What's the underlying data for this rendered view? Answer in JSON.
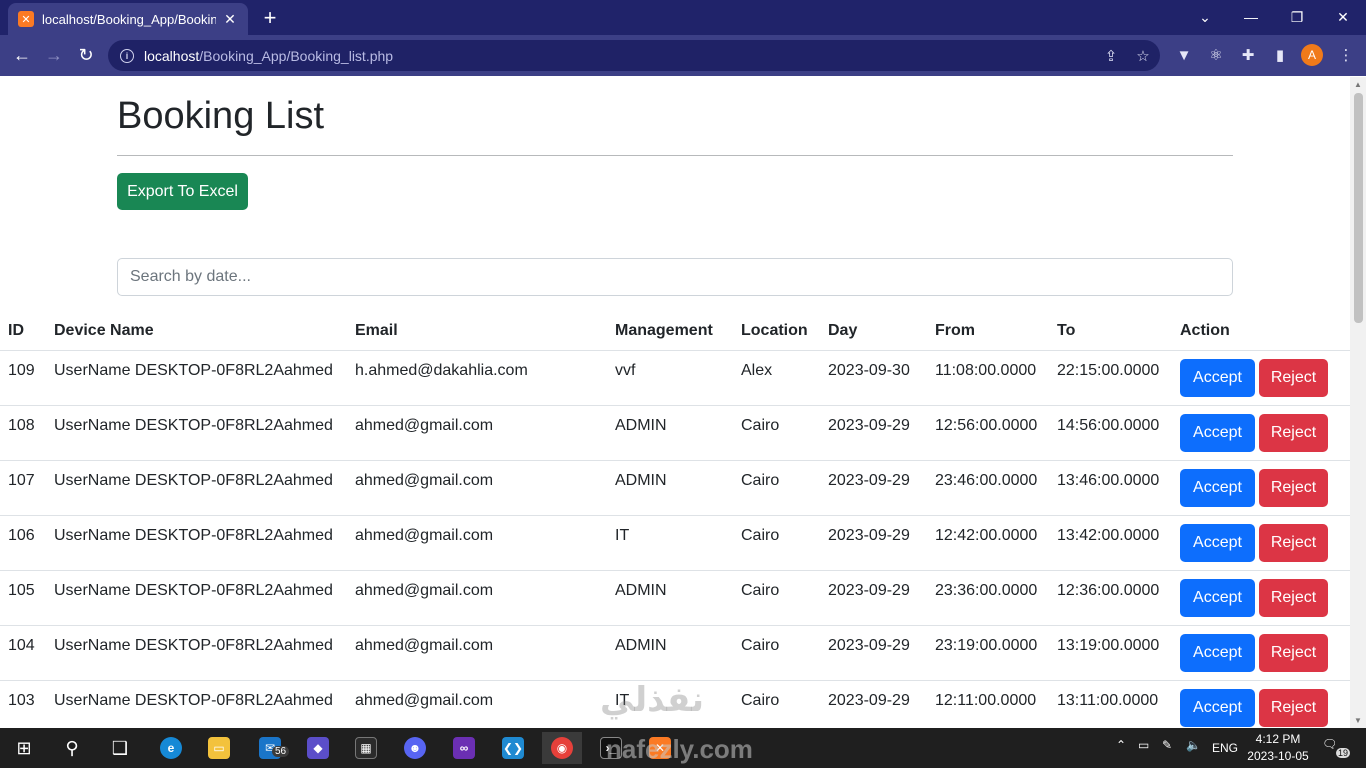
{
  "browser": {
    "tab_title": "localhost/Booking_App/Booking",
    "url_host": "localhost",
    "url_path": "/Booking_App/Booking_list.php",
    "profile_initial": "A"
  },
  "page": {
    "title": "Booking List",
    "export_label": "Export To Excel",
    "search_placeholder": "Search by date..."
  },
  "table": {
    "headers": [
      "ID",
      "Device Name",
      "Email",
      "Management",
      "Location",
      "Day",
      "From",
      "To",
      "Action"
    ],
    "accept_label": "Accept",
    "reject_label": "Reject",
    "rows": [
      {
        "id": "109",
        "device": "UserName DESKTOP-0F8RL2Aahmed",
        "email": "h.ahmed@dakahlia.com",
        "management": "vvf",
        "location": "Alex",
        "day": "2023-09-30",
        "from": "11:08:00.0000",
        "to": "22:15:00.0000"
      },
      {
        "id": "108",
        "device": "UserName DESKTOP-0F8RL2Aahmed",
        "email": "ahmed@gmail.com",
        "management": "ADMIN",
        "location": "Cairo",
        "day": "2023-09-29",
        "from": "12:56:00.0000",
        "to": "14:56:00.0000"
      },
      {
        "id": "107",
        "device": "UserName DESKTOP-0F8RL2Aahmed",
        "email": "ahmed@gmail.com",
        "management": "ADMIN",
        "location": "Cairo",
        "day": "2023-09-29",
        "from": "23:46:00.0000",
        "to": "13:46:00.0000"
      },
      {
        "id": "106",
        "device": "UserName DESKTOP-0F8RL2Aahmed",
        "email": "ahmed@gmail.com",
        "management": "IT",
        "location": "Cairo",
        "day": "2023-09-29",
        "from": "12:42:00.0000",
        "to": "13:42:00.0000"
      },
      {
        "id": "105",
        "device": "UserName DESKTOP-0F8RL2Aahmed",
        "email": "ahmed@gmail.com",
        "management": "ADMIN",
        "location": "Cairo",
        "day": "2023-09-29",
        "from": "23:36:00.0000",
        "to": "12:36:00.0000"
      },
      {
        "id": "104",
        "device": "UserName DESKTOP-0F8RL2Aahmed",
        "email": "ahmed@gmail.com",
        "management": "ADMIN",
        "location": "Cairo",
        "day": "2023-09-29",
        "from": "23:19:00.0000",
        "to": "13:19:00.0000"
      },
      {
        "id": "103",
        "device": "UserName DESKTOP-0F8RL2Aahmed",
        "email": "ahmed@gmail.com",
        "management": "IT",
        "location": "Cairo",
        "day": "2023-09-29",
        "from": "12:11:00.0000",
        "to": "13:11:00.0000"
      }
    ]
  },
  "taskbar": {
    "mail_badge": "56",
    "language": "ENG",
    "time": "4:12 PM",
    "date": "2023-10-05",
    "notifications": "19"
  },
  "watermark": {
    "arabic": "نفذلي",
    "latin": "nafezly.com"
  },
  "colors": {
    "tabstrip": "#20236a",
    "toolbar": "#3c3f86",
    "export": "#198754",
    "accept": "#0d6efd",
    "reject": "#dc3545"
  }
}
